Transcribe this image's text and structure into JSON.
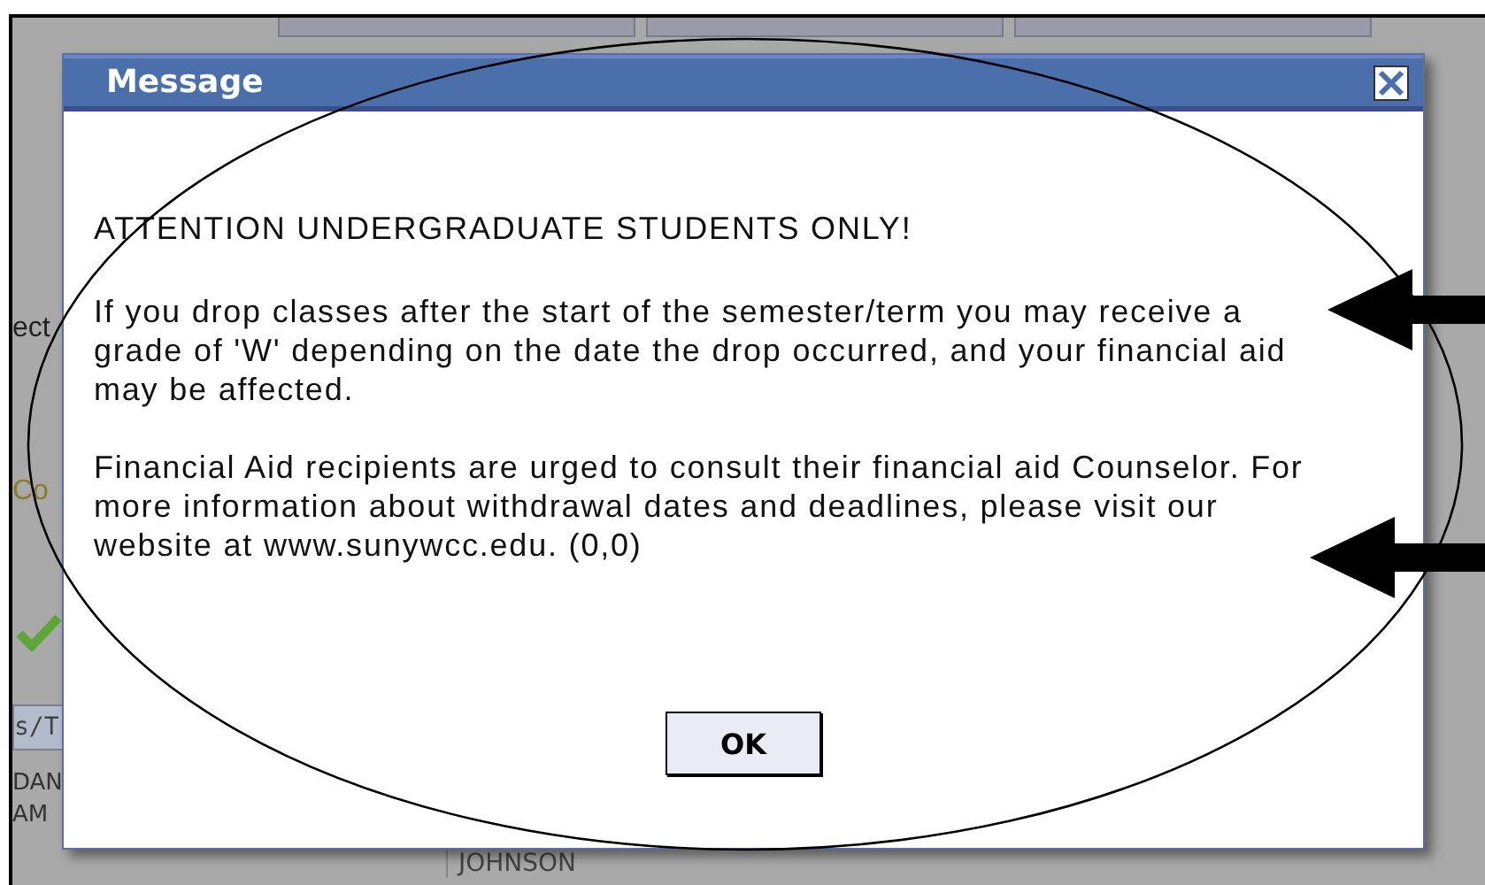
{
  "background": {
    "fragments": [
      {
        "text": "ect",
        "color": "#222222"
      },
      {
        "text": "Co",
        "color": "#8a7a2a"
      }
    ],
    "tab_fragment": "s/T",
    "times": [
      "DAN",
      "AM"
    ],
    "instructor": "JOHNSON"
  },
  "dialog": {
    "title": "Message",
    "heading": "ATTENTION UNDERGRADUATE STUDENTS ONLY!",
    "paragraphs": [
      "If you drop classes after the start of the semester/term you may receive a grade of 'W' depending on the date the drop occurred, and your financial aid may be affected.",
      "Financial Aid recipients are urged to consult their financial aid Counselor.  For more information about withdrawal dates and deadlines, please visit our website at www.sunywcc.edu.  (0,0)"
    ],
    "button": "OK"
  }
}
